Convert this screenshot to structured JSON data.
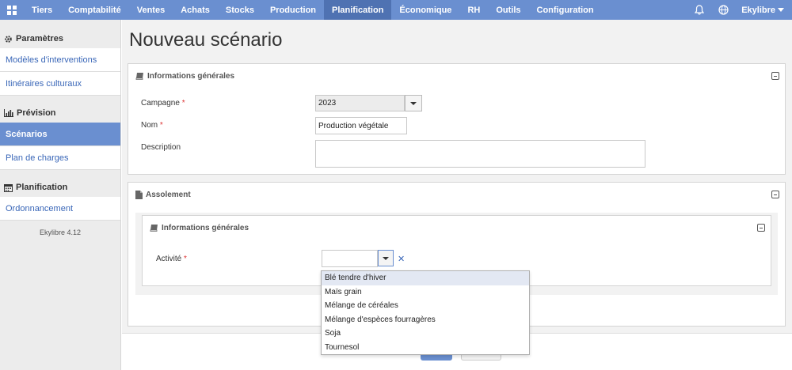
{
  "nav": {
    "items": [
      {
        "label": "Tiers"
      },
      {
        "label": "Comptabilité"
      },
      {
        "label": "Ventes"
      },
      {
        "label": "Achats"
      },
      {
        "label": "Stocks"
      },
      {
        "label": "Production"
      },
      {
        "label": "Planification"
      },
      {
        "label": "Économique"
      },
      {
        "label": "RH"
      },
      {
        "label": "Outils"
      },
      {
        "label": "Configuration"
      }
    ],
    "active": "Planification",
    "user": "Ekylibre"
  },
  "sidebar": {
    "sections": [
      {
        "title": "Paramètres",
        "icon": "gear-icon",
        "links": [
          {
            "label": "Modèles d'interventions"
          },
          {
            "label": "Itinéraires culturaux"
          }
        ]
      },
      {
        "title": "Prévision",
        "icon": "bar-chart-icon",
        "links": [
          {
            "label": "Scénarios"
          },
          {
            "label": "Plan de charges"
          }
        ]
      },
      {
        "title": "Planification",
        "icon": "calendar-icon",
        "links": [
          {
            "label": "Ordonnancement"
          }
        ]
      }
    ],
    "active_link": "Scénarios",
    "version": "Ekylibre 4.12"
  },
  "page": {
    "title": "Nouveau scénario"
  },
  "general": {
    "title": "Informations générales",
    "campagne_label": "Campagne",
    "campagne_value": "2023",
    "nom_label": "Nom",
    "nom_value": "Production végétale",
    "description_label": "Description",
    "description_value": "",
    "required_mark": "*"
  },
  "assolement": {
    "title": "Assolement",
    "sub_title": "Informations générales",
    "activite_label": "Activité",
    "activite_value": "",
    "clear_symbol": "✕",
    "options": [
      {
        "label": "Blé tendre d'hiver"
      },
      {
        "label": "Maïs grain"
      },
      {
        "label": "Mélange de céréales"
      },
      {
        "label": "Mélange d'espèces fourragères"
      },
      {
        "label": "Soja"
      },
      {
        "label": "Tournesol"
      }
    ],
    "highlighted_option": "Blé tendre d'hiver"
  },
  "colors": {
    "accent": "#6a8fd0",
    "accent_dark": "#4f72b2",
    "link": "#3a67b8",
    "required": "#dd3333"
  }
}
